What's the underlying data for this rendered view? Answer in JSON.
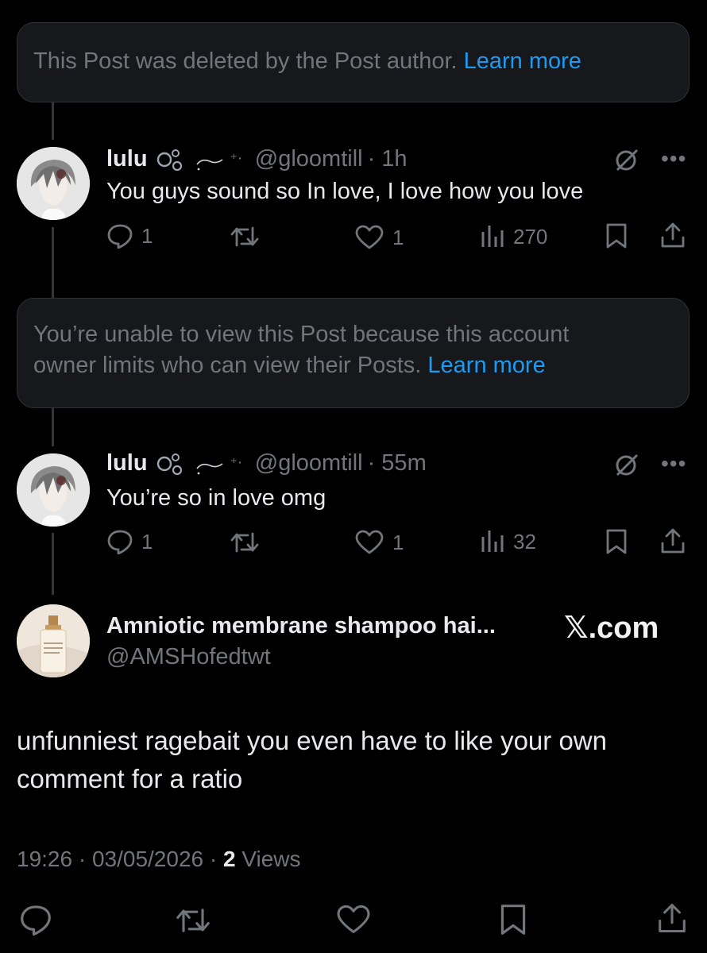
{
  "notices": {
    "deleted": {
      "text": "This Post was deleted by the Post author. ",
      "link": "Learn more"
    },
    "restricted": {
      "line1": "You’re unable to view this Post because this account",
      "line2": "owner limits who can view their Posts. ",
      "link": "Learn more"
    }
  },
  "reply1": {
    "name": "lulu",
    "decor": "⁺‧",
    "handle": "@gloomtill",
    "time": "· 1h",
    "text": "You guys sound so In love, I love how you love",
    "replies": "1",
    "likes": "1",
    "views": "270"
  },
  "reply2": {
    "name": "lulu",
    "decor": "⁺‧",
    "handle": "@gloomtill",
    "time": "· 55m",
    "text": "You’re so in love omg",
    "replies": "1",
    "likes": "1",
    "views": "32"
  },
  "main_post": {
    "name": "Amniotic membrane shampoo hai...",
    "handle": "@AMSHofedtwt",
    "watermark": "𝕏.com",
    "text_line1": "unfunniest ragebait you even have to like your own",
    "text_line2": "comment for a ratio",
    "time": "19:26 · 03/05/2026 · ",
    "views_count": "2",
    "views_label": " Views"
  },
  "colors": {
    "background": "#000000",
    "text": "#e7e9ea",
    "muted": "#71767b",
    "link": "#1d9bf0",
    "notice_bg": "#16181c"
  },
  "icons": [
    "reply-icon",
    "retweet-icon",
    "like-icon",
    "views-icon",
    "bookmark-icon",
    "share-icon",
    "grok-icon",
    "more-icon"
  ]
}
